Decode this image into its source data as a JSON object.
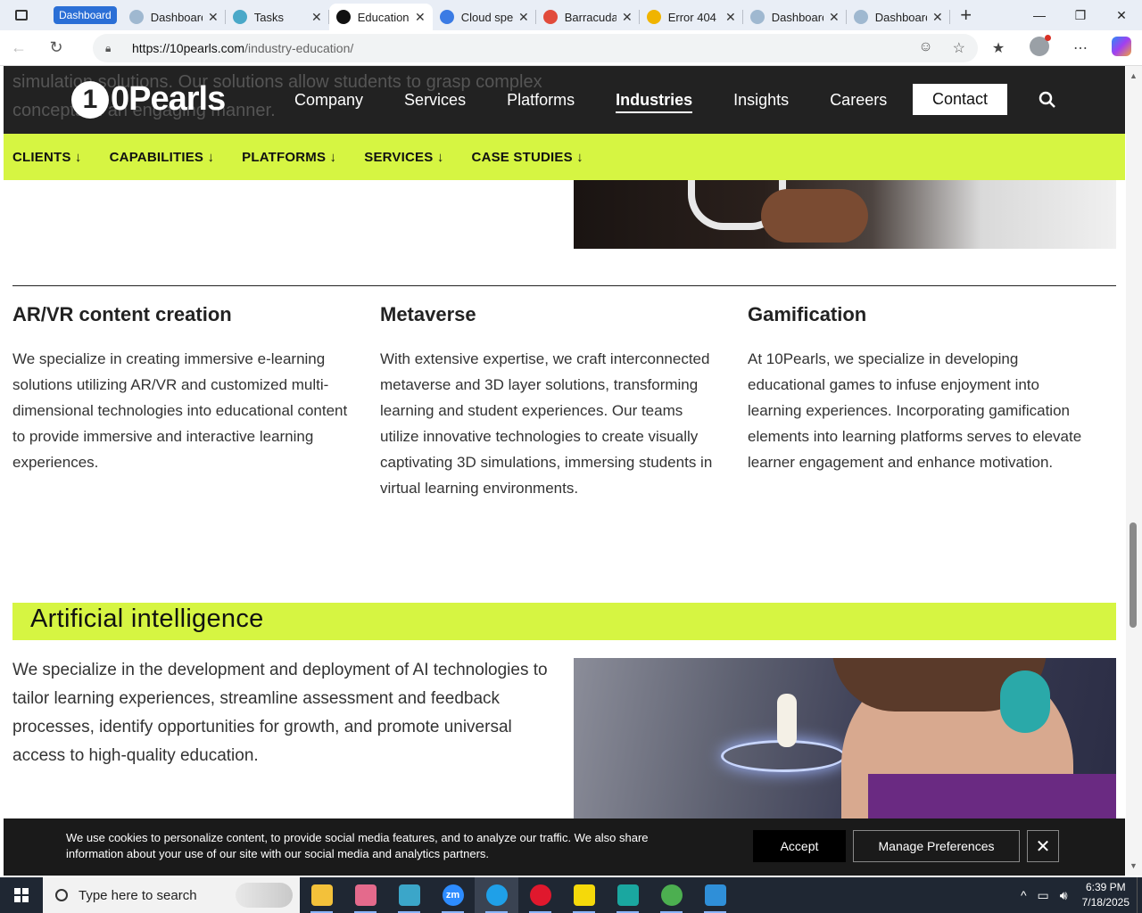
{
  "browser": {
    "tab_group_label": "Dashboard",
    "tabs": [
      {
        "title": "Dashboard",
        "icon": "dashboard-icon",
        "color": "#9fb8d0"
      },
      {
        "title": "Tasks",
        "icon": "tasks-icon",
        "color": "#4aa8c8"
      },
      {
        "title": "Education",
        "icon": "10pearls-icon",
        "color": "#111111",
        "active": true
      },
      {
        "title": "Cloud spe",
        "icon": "docs-icon",
        "color": "#3b7be4"
      },
      {
        "title": "Barracuda",
        "icon": "barracuda-icon",
        "color": "#e14b3b"
      },
      {
        "title": "Error 404 (",
        "icon": "warning-icon",
        "color": "#f0b400"
      },
      {
        "title": "Dashboard",
        "icon": "dashboard-icon",
        "color": "#9fb8d0"
      },
      {
        "title": "Dashboard",
        "icon": "dashboard-icon",
        "color": "#9fb8d0"
      }
    ],
    "url_host": "https://10pearls.com",
    "url_path": "/industry-education/"
  },
  "site": {
    "ghost_text": "simulation solutions. Our solutions allow students to grasp complex concepts in an engaging manner.",
    "logo_mark": "1",
    "logo_word": "0Pearls",
    "nav": [
      "Company",
      "Services",
      "Platforms",
      "Industries",
      "Insights",
      "Careers"
    ],
    "nav_active": "Industries",
    "contact_label": "Contact",
    "subnav": [
      "CLIENTS ↓",
      "CAPABILITIES ↓",
      "PLATFORMS ↓",
      "SERVICES ↓",
      "CASE STUDIES ↓"
    ],
    "accent": "#d6f542"
  },
  "content": {
    "columns": [
      {
        "title": "AR/VR content creation",
        "body": "We specialize in creating immersive e-learning solutions utilizing AR/VR and customized multi-dimensional technologies into educational content to provide immersive and interactive learning experiences."
      },
      {
        "title": "Metaverse",
        "body": "With extensive expertise, we craft interconnected metaverse and 3D layer solutions, transforming learning and student experiences. Our teams utilize innovative technologies to create visually captivating 3D simulations, immersing students in virtual learning environments."
      },
      {
        "title": "Gamification",
        "body": "At 10Pearls, we specialize in developing educational games to infuse enjoyment into learning experiences. Incorporating gamification elements into learning platforms serves to elevate learner engagement and enhance motivation."
      }
    ],
    "ai_heading": "Artificial intelligence",
    "ai_body": "We specialize in the development and deployment of AI technologies to tailor learning experiences, streamline assessment and feedback processes, identify opportunities for growth, and promote universal access to high-quality education."
  },
  "cookie": {
    "message": "We use cookies to personalize content, to provide social media features, and to analyze our traffic. We also share information about your use of our site with our social media and analytics partners.",
    "accept_label": "Accept",
    "manage_label": "Manage Preferences",
    "close_symbol": "✕"
  },
  "taskbar": {
    "search_placeholder": "Type here to search",
    "apps": [
      {
        "name": "file-explorer",
        "color": "#f3c13a"
      },
      {
        "name": "paint",
        "color": "#e46a8c"
      },
      {
        "name": "app-diamond",
        "color": "#3ba6c9"
      },
      {
        "name": "zoom",
        "color": "#2d8cff",
        "label": "zm"
      },
      {
        "name": "edge",
        "color": "#1fa0e8",
        "active": true
      },
      {
        "name": "opera",
        "color": "#e0182d"
      },
      {
        "name": "sticky-notes",
        "color": "#f5d90a"
      },
      {
        "name": "app-s",
        "color": "#1aa7a0"
      },
      {
        "name": "chrome",
        "color": "#4caf50"
      },
      {
        "name": "vscode",
        "color": "#2f8fd8"
      }
    ],
    "time": "6:39 PM",
    "date": "7/18/2025"
  }
}
